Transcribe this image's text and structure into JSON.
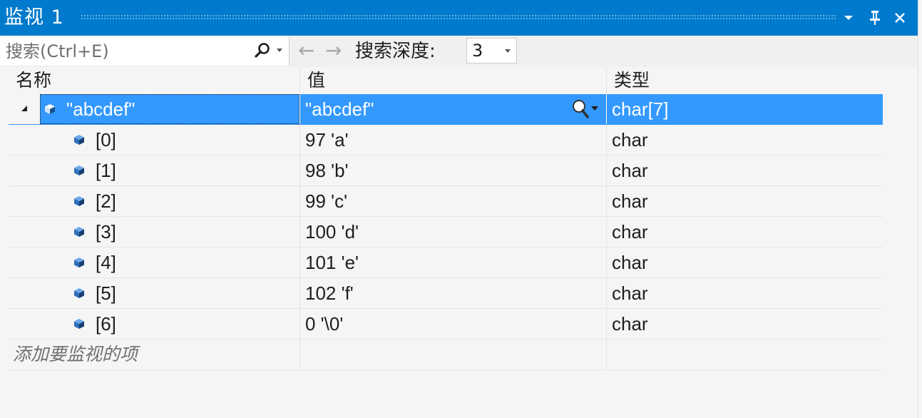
{
  "window": {
    "title": "监视 1",
    "icons": [
      "chevron-down-icon",
      "pin-icon",
      "close-icon"
    ]
  },
  "toolbar": {
    "search_placeholder": "搜索(Ctrl+E)",
    "search_value": "",
    "back_arrow": "←",
    "forward_arrow": "→",
    "depth_label": "搜索深度:",
    "depth_value": "3"
  },
  "columns": {
    "name": "名称",
    "value": "值",
    "type": "类型"
  },
  "rows": [
    {
      "name": "\"abcdef\"",
      "value": "\"abcdef\"",
      "type": "char[7]",
      "expanded": true,
      "selected": true
    },
    {
      "name": "[0]",
      "value": "97 'a'",
      "type": "char"
    },
    {
      "name": "[1]",
      "value": "98 'b'",
      "type": "char"
    },
    {
      "name": "[2]",
      "value": "99 'c'",
      "type": "char"
    },
    {
      "name": "[3]",
      "value": "100 'd'",
      "type": "char"
    },
    {
      "name": "[4]",
      "value": "101 'e'",
      "type": "char"
    },
    {
      "name": "[5]",
      "value": "102 'f'",
      "type": "char"
    },
    {
      "name": "[6]",
      "value": "0 '\\0'",
      "type": "char"
    }
  ],
  "add_watch_placeholder": "添加要监视的项",
  "colors": {
    "titlebar": "#007acc",
    "selection": "#3399ff",
    "cube": "#1e5fa8"
  }
}
